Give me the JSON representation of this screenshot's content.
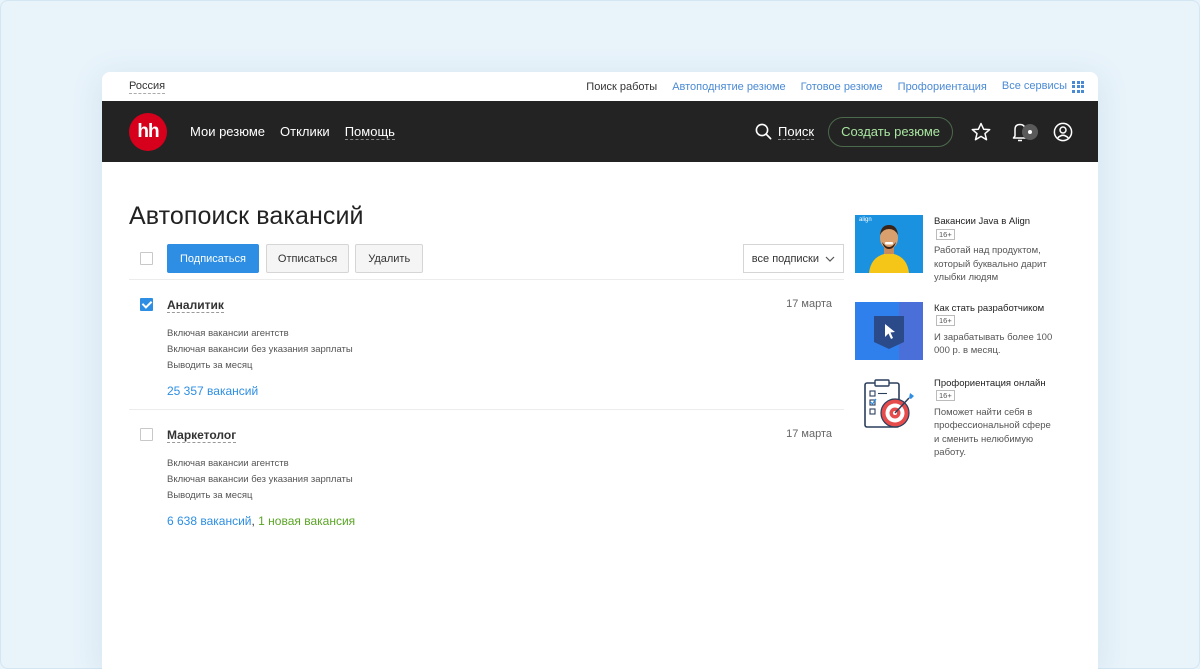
{
  "topbar": {
    "region": "Россия",
    "links": [
      "Поиск работы",
      "Автоподнятие резюме",
      "Готовое резюме",
      "Профориентация",
      "Все сервисы"
    ]
  },
  "header": {
    "logo": "hh",
    "nav": [
      "Мои резюме",
      "Отклики",
      "Помощь"
    ],
    "search_label": "Поиск",
    "create_label": "Создать резюме"
  },
  "main": {
    "title": "Автопоиск вакансий",
    "subscribe_label": "Подписаться",
    "unsubscribe_label": "Отписаться",
    "delete_label": "Удалить",
    "filter_label": "все подписки",
    "subscriptions": [
      {
        "name": "Аналитик",
        "date": "17 марта",
        "checked": true,
        "options": [
          "Включая вакансии агентств",
          "Включая вакансии без указания зарплаты",
          "Выводить за месяц"
        ],
        "count": "25 357 вакансий",
        "new": ""
      },
      {
        "name": "Маркетолог",
        "date": "17 марта",
        "checked": false,
        "options": [
          "Включая вакансии агентств",
          "Включая вакансии без указания зарплаты",
          "Выводить за месяц"
        ],
        "count": "6 638 вакансий",
        "new": "1 новая вакансия"
      }
    ]
  },
  "ads": [
    {
      "title": "Вакансии Java в Align",
      "age": "16+",
      "desc": "Работай над продуктом, который буквально дарит улыбки людям",
      "image_label": "align"
    },
    {
      "title": "Как стать разработчиком",
      "age": "16+",
      "desc": "И зарабатывать более 100 000 р. в месяц."
    },
    {
      "title": "Профориентация онлайн",
      "age": "16+",
      "desc": "Поможет найти себя в профессиональной сфере и сменить нелюбимую работу."
    }
  ],
  "colors": {
    "accent": "#2d8ee3",
    "brand": "#d6001c",
    "header_bg": "#232323",
    "new_green": "#5aa425"
  }
}
